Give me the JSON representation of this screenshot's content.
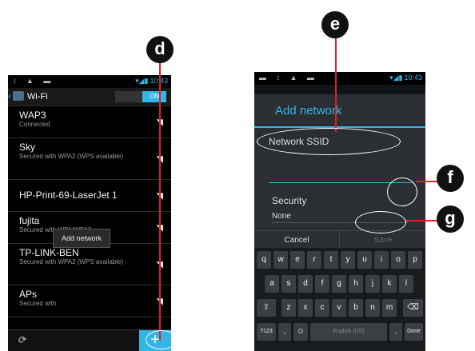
{
  "callouts": {
    "d": "d",
    "e": "e",
    "f": "f",
    "g": "g"
  },
  "left_phone": {
    "statusbar": {
      "icons_left": "↕ ▲ ▬",
      "time": "10:43"
    },
    "actionbar": {
      "title": "Wi-Fi",
      "toggle_label": "ON"
    },
    "networks": [
      {
        "ssid": "WAP3",
        "sub": "Connected"
      },
      {
        "ssid": "Sky",
        "sub": "Secured with WPA2 (WPS available)"
      },
      {
        "ssid": "HP-Print-69-LaserJet 1",
        "sub": ""
      },
      {
        "ssid": "fujita",
        "sub": "Secured with WPA/WPA2"
      },
      {
        "ssid": "TP-LINK-BEN",
        "sub": "Secured with WPA2 (WPS available)"
      },
      {
        "ssid": "APs",
        "sub": "Secured with"
      }
    ],
    "tooltip": "Add network",
    "add_button": "+"
  },
  "right_phone": {
    "statusbar": {
      "icons_left": "▬ ↕ ▲ ▬",
      "time": "10:43"
    },
    "dialog": {
      "title": "Add network",
      "ssid_label": "Network SSID",
      "security_label": "Security",
      "security_value": "None",
      "cancel": "Cancel",
      "save": "Save"
    },
    "keyboard": {
      "row1": [
        "q",
        "w",
        "e",
        "r",
        "t",
        "y",
        "u",
        "i",
        "o",
        "p"
      ],
      "row2": [
        "a",
        "s",
        "d",
        "f",
        "g",
        "h",
        "j",
        "k",
        "l"
      ],
      "row3": [
        "⇧",
        "z",
        "x",
        "c",
        "v",
        "b",
        "n",
        "m",
        "⌫"
      ],
      "row4": [
        "?123",
        ",",
        "☺",
        "English (US)",
        ".",
        "Done"
      ]
    }
  }
}
